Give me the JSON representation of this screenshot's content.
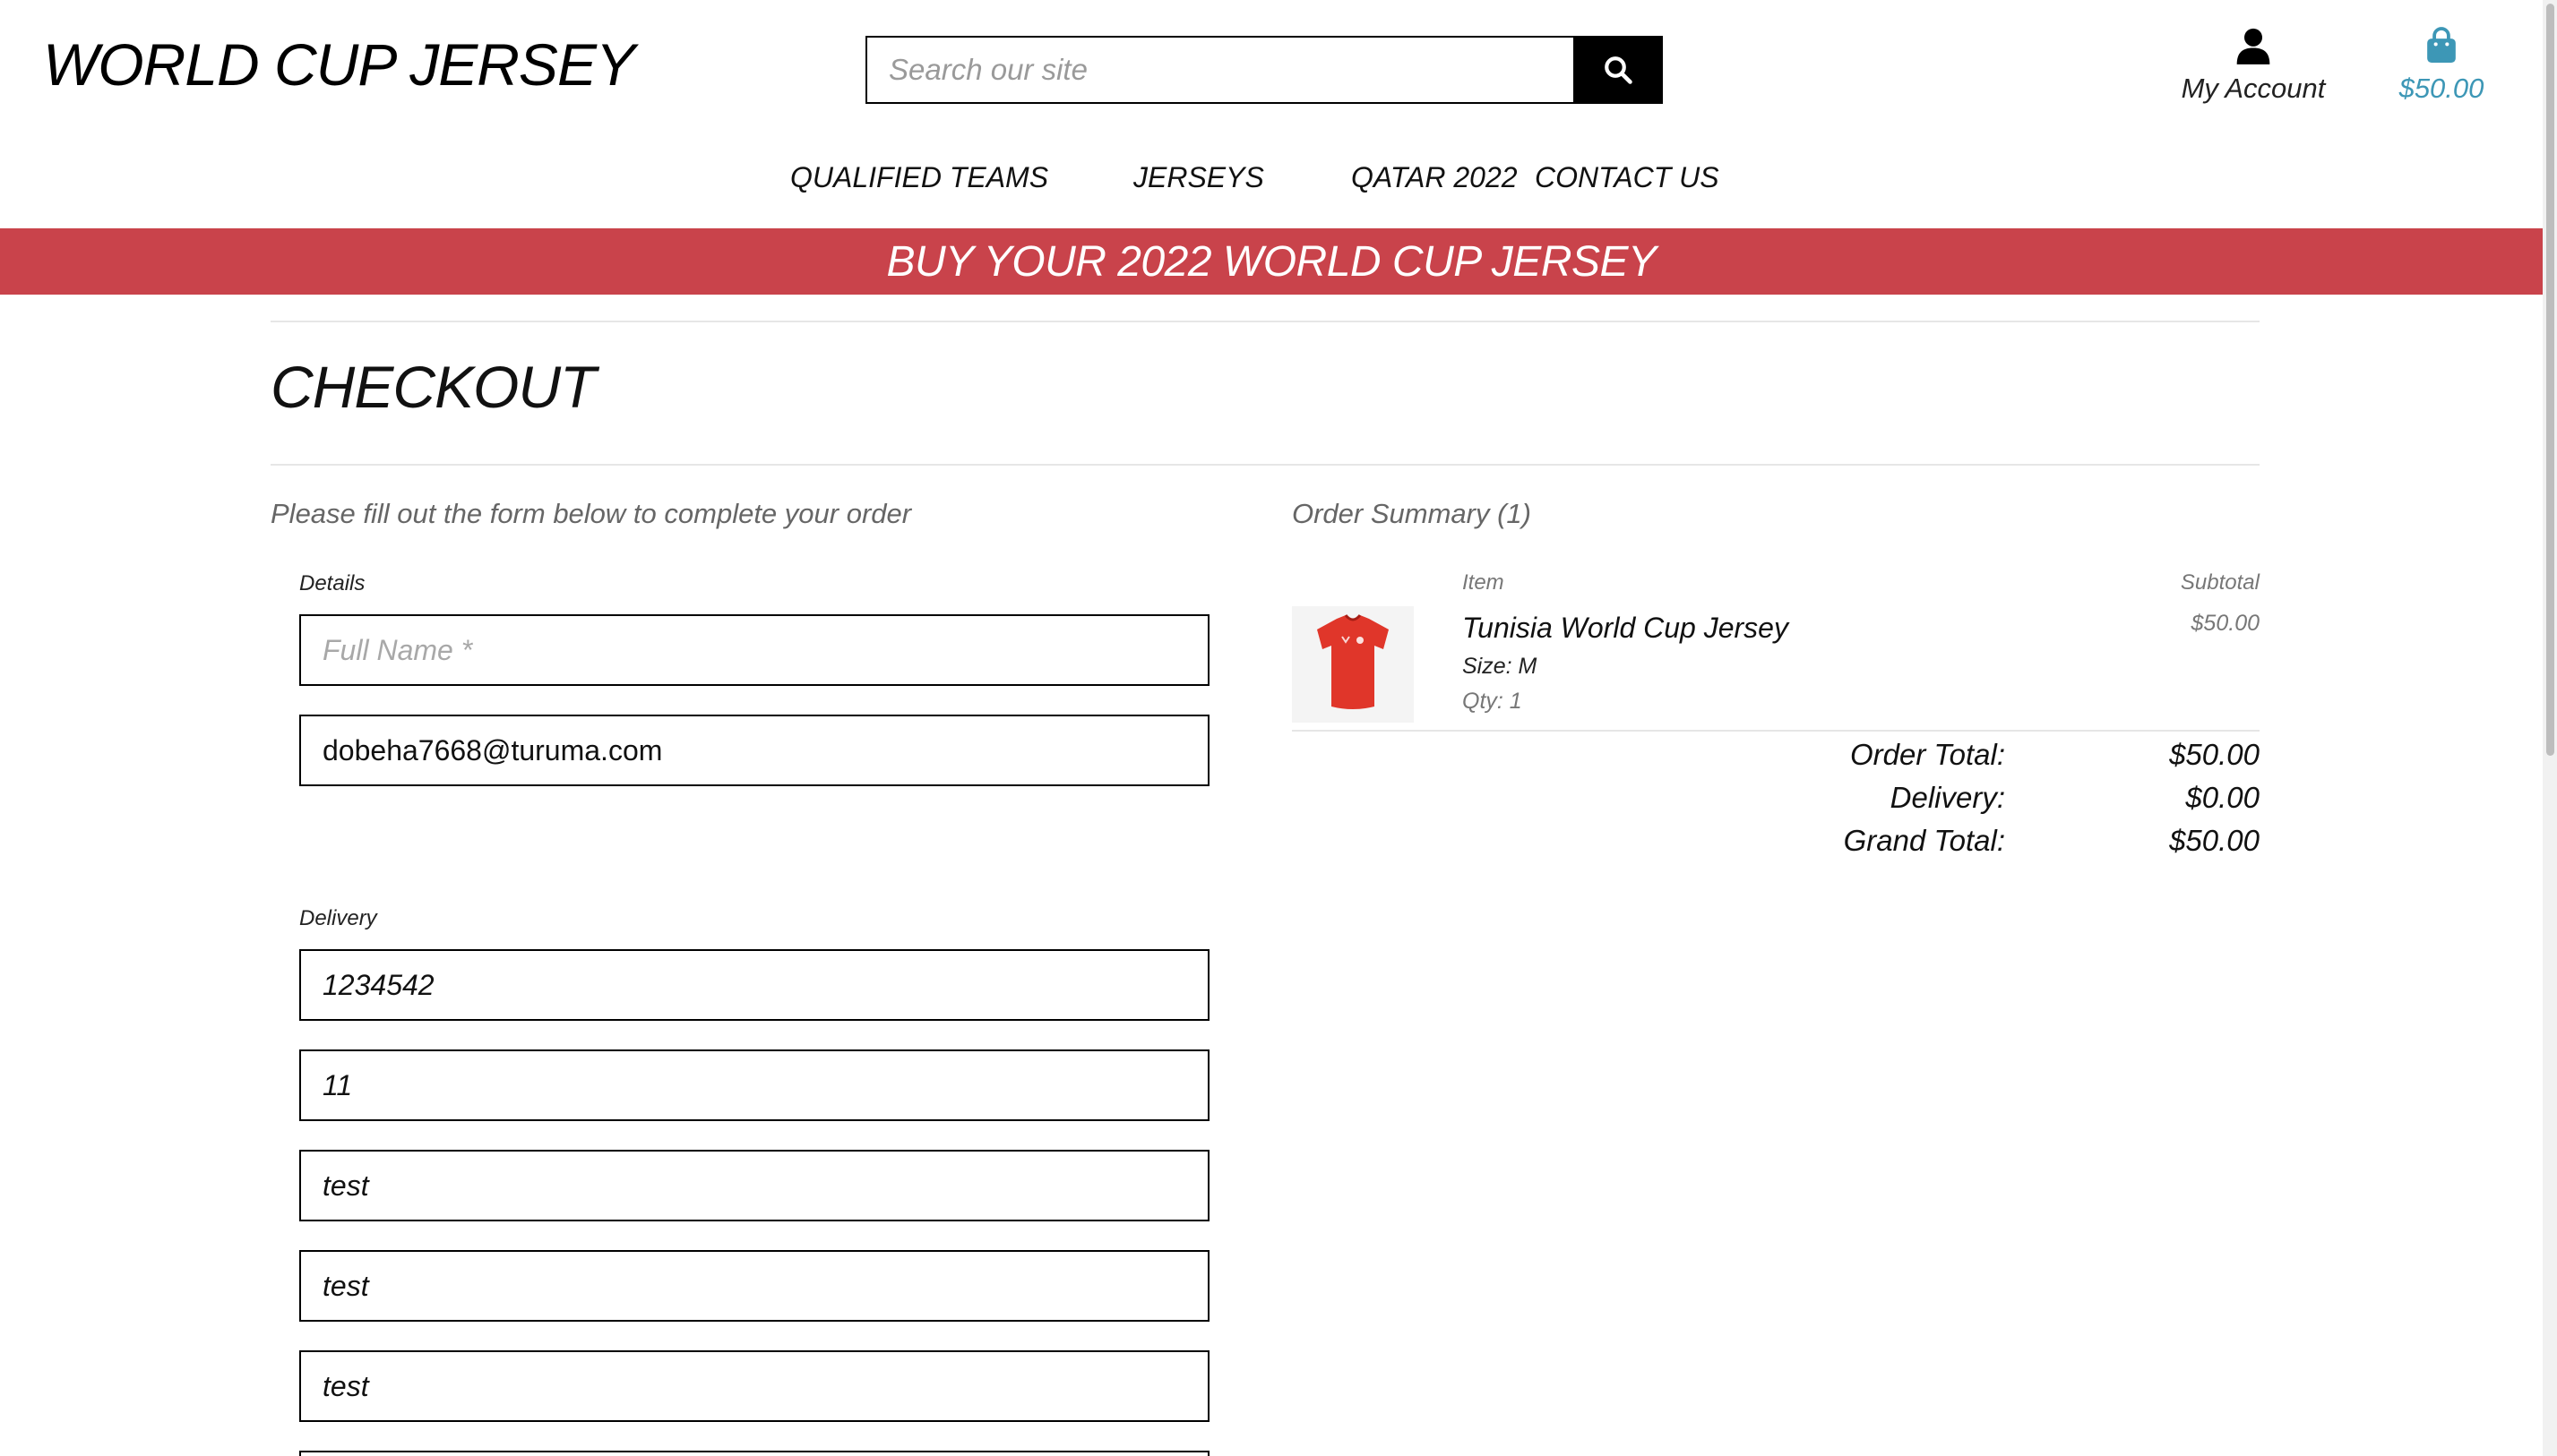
{
  "header": {
    "logo": "WORLD CUP JERSEY",
    "search_placeholder": "Search our site",
    "account_label": "My Account",
    "cart_total": "$50.00"
  },
  "nav": {
    "items": [
      "QUALIFIED TEAMS",
      "JERSEYS",
      "QATAR 2022",
      "CONTACT US"
    ]
  },
  "banner": {
    "text": "BUY YOUR 2022 WORLD CUP JERSEY"
  },
  "checkout": {
    "title": "CHECKOUT",
    "lead": "Please fill out the form below to complete your order",
    "details_label": "Details",
    "full_name_placeholder": "Full Name *",
    "email_value": "dobeha7668@turuma.com",
    "delivery_label": "Delivery",
    "delivery_fields": [
      "1234542",
      "11",
      "test",
      "test",
      "test"
    ]
  },
  "summary": {
    "heading": "Order Summary (1)",
    "item_col": "Item",
    "subtotal_col": "Subtotal",
    "item": {
      "name": "Tunisia World Cup Jersey",
      "size": "Size: M",
      "qty": "Qty: 1",
      "subtotal": "$50.00"
    },
    "order_total_label": "Order Total:",
    "order_total": "$50.00",
    "delivery_label": "Delivery:",
    "delivery": "$0.00",
    "grand_total_label": "Grand Total:",
    "grand_total": "$50.00"
  },
  "colors": {
    "banner": "#c9434b",
    "cart_accent": "#3d97b6",
    "jersey": "#e0362a"
  },
  "icons": [
    "search-icon",
    "user-icon",
    "shopping-bag-icon"
  ]
}
